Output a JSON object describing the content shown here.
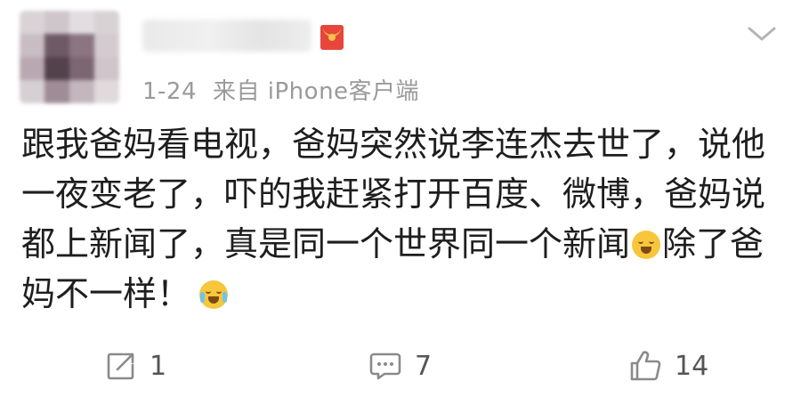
{
  "post": {
    "timestamp": "1-24",
    "source": "来自 iPhone客户端",
    "content_lines": [
      "跟我爸妈看电视，爸妈突然说李连杰去世了，说他",
      "一夜变老了，吓的我赶紧打开百度、微博，爸妈说",
      "都上新闻了，真是同一个世界同一个新闻",
      "除了爸",
      "妈不一样！"
    ]
  },
  "actions": {
    "repost_count": "1",
    "comment_count": "7",
    "like_count": "14"
  },
  "icons": {
    "avatar": "avatar-blurred",
    "badge": "red-envelope-icon",
    "menu": "chevron-down-icon",
    "repost": "repost-icon",
    "comment": "comment-icon",
    "like": "thumbs-up-icon",
    "emoji_crying": "crying-emoji-icon",
    "emoji_laughing": "laugh-crying-emoji-icon"
  },
  "colors": {
    "meta_text": "#9a9a9a",
    "content_text": "#1e1e1e",
    "badge": "#e8453c"
  }
}
